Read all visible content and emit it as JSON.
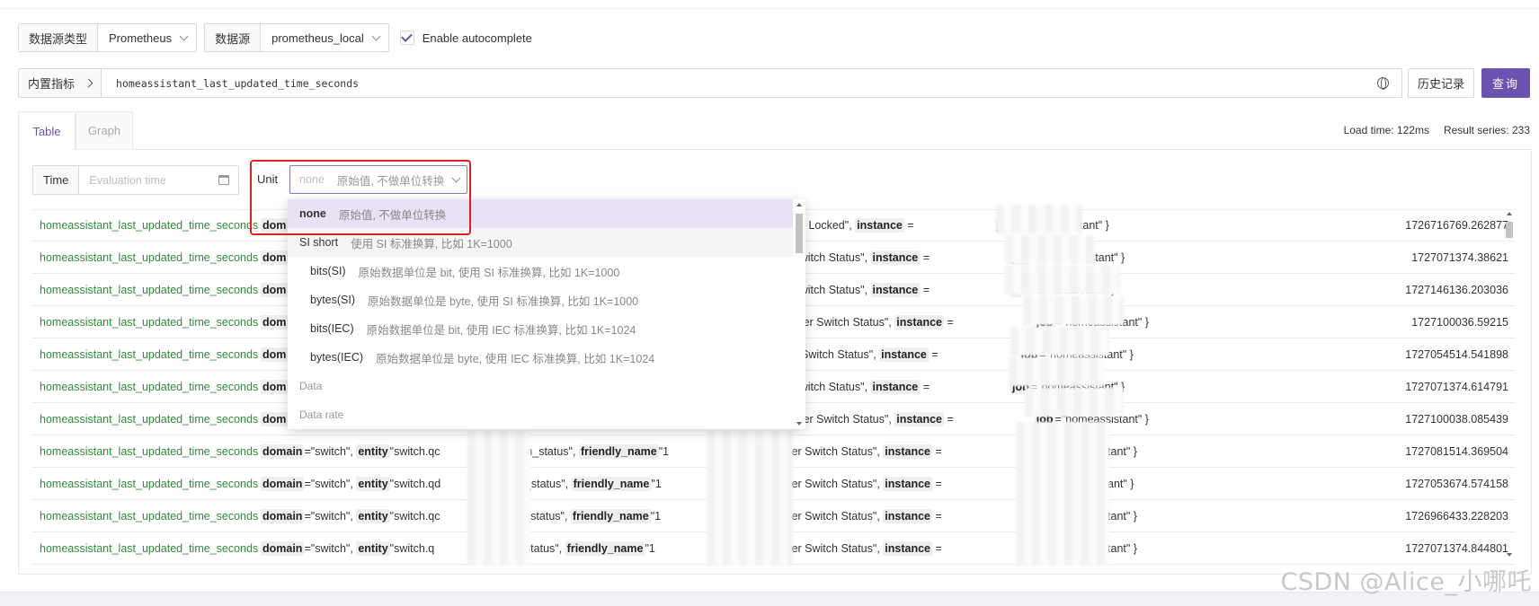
{
  "toolbar": {
    "datasource_type_label": "数据源类型",
    "datasource_type_value": "Prometheus",
    "datasource_label": "数据源",
    "datasource_value": "prometheus_local",
    "autocomplete_label": "Enable autocomplete"
  },
  "query": {
    "builtin_label": "内置指标",
    "text": "homeassistant_last_updated_time_seconds",
    "history_button": "历史记录",
    "query_button": "查询"
  },
  "tabs": [
    {
      "label": "Table",
      "active": true
    },
    {
      "label": "Graph",
      "active": false
    }
  ],
  "stats": {
    "load_time": "Load time: 122ms",
    "result_series": "Result series: 233"
  },
  "controls": {
    "time_label": "Time",
    "time_placeholder": "Evaluation time",
    "unit_label": "Unit",
    "unit_value": "none",
    "unit_desc": "原始值, 不做单位转换"
  },
  "dropdown": [
    {
      "kind": "option",
      "name": "none",
      "desc": "原始值, 不做单位转换",
      "selected": true
    },
    {
      "kind": "option",
      "name": "SI short",
      "desc": "使用 SI 标准换算, 比如 1K=1000",
      "hover": true
    },
    {
      "kind": "group",
      "name": "Data"
    },
    {
      "kind": "option",
      "name": "bits(SI)",
      "desc": "原始数据单位是 bit, 使用 SI 标准换算, 比如 1K=1000",
      "indent": true
    },
    {
      "kind": "option",
      "name": "bytes(SI)",
      "desc": "原始数据单位是 byte, 使用 SI 标准换算, 比如 1K=1000",
      "indent": true
    },
    {
      "kind": "option",
      "name": "bits(IEC)",
      "desc": "原始数据单位是 bit, 使用 IEC 标准换算, 比如 1K=1024",
      "indent": true
    },
    {
      "kind": "option",
      "name": "bytes(IEC)",
      "desc": "原始数据单位是 byte, 使用 IEC 标准换算, 比如 1K=1024",
      "indent": true
    },
    {
      "kind": "group",
      "name": "Data rate"
    }
  ],
  "rows": [
    {
      "metric": "homeassistant_last_updated_time_seconds",
      "labels_full": false,
      "tail": "hysical Control Locked\",",
      "job_prefix": "job",
      "value": "1726716769.262877"
    },
    {
      "metric": "homeassistant_last_updated_time_seconds",
      "labels_full": false,
      "tail": " Conditioner Switch Status\",",
      "job_prefix": "job",
      "value": "1727071374.38621"
    },
    {
      "metric": "homeassistant_last_updated_time_seconds",
      "labels_full": false,
      "tail": " Conditioner Switch Status\",",
      "job_prefix": "b",
      "value": "1727146136.203036"
    },
    {
      "metric": "homeassistant_last_updated_time_seconds",
      "labels_full": false,
      "tail": " Air Conditioner Switch Status\",",
      "job_prefix": "job",
      "value": "1727100036.59215"
    },
    {
      "metric": "homeassistant_last_updated_time_seconds",
      "labels_full": false,
      "tail": "r Conditioner Switch Status\",",
      "job_prefix": "job",
      "value": "1727054514.541898"
    },
    {
      "metric": "homeassistant_last_updated_time_seconds",
      "labels_full": false,
      "tail": " Conditioner Switch Status\",",
      "job_prefix": "job",
      "value": "1727071374.614791"
    },
    {
      "metric": "homeassistant_last_updated_time_seconds",
      "labels_full": false,
      "tail": " Air Conditioner Switch Status\",",
      "job_prefix": "job",
      "value": "1727100038.085439"
    },
    {
      "metric": "homeassistant_last_updated_time_seconds",
      "labels_full": true,
      "entity": "\"switch.qc",
      "switch_tail": "switch_status\",",
      "fn": "\"1",
      "tail": "Air Conditioner Switch Status\",",
      "job_prefix": "job",
      "value": "1727081514.369504"
    },
    {
      "metric": "homeassistant_last_updated_time_seconds",
      "labels_full": true,
      "entity": "\"switch.qd",
      "switch_tail": "vitch_status\",",
      "fn": "\"1",
      "tail": "Air Conditioner Switch Status\",",
      "job_prefix": "ob",
      "value": "1727053674.574158"
    },
    {
      "metric": "homeassistant_last_updated_time_seconds",
      "labels_full": true,
      "entity": "\"switch.qc",
      "switch_tail": "vitch_status\",",
      "fn": "\"1",
      "tail": "Air Conditioner Switch Status\",",
      "job_prefix": "job",
      "value": "1726966433.228203"
    },
    {
      "metric": "homeassistant_last_updated_time_seconds",
      "labels_full": true,
      "entity": "\"switch.q",
      "switch_tail": "vitch_status\",",
      "fn": "\"1",
      "tail": "Air Conditioner Switch Status\",",
      "job_prefix": "job",
      "value": "1727071374.844801"
    }
  ],
  "strings": {
    "domain_key": "domain",
    "domain_val": "=\"switch\",",
    "entity_key": "entity",
    "friendly_key": "friendly_name",
    "instance_key": "instance",
    "job_val": "=\"homeassistant\" }",
    "brace_open": " {",
    "dom_trunc": "dom"
  },
  "watermark": "CSDN @Alice_小哪吒"
}
